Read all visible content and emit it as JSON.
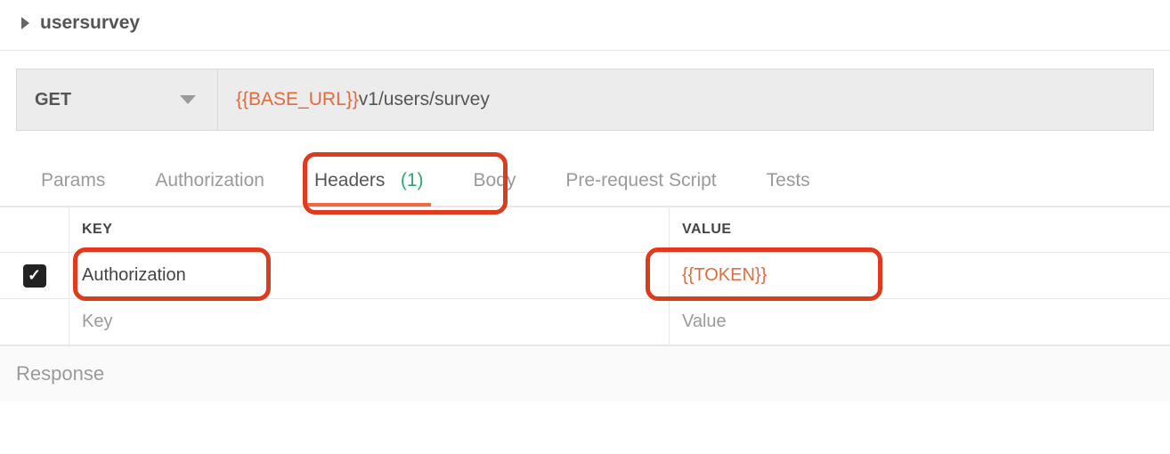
{
  "request": {
    "name": "usersurvey",
    "method": "GET",
    "url_variable": "{{BASE_URL}}",
    "url_path": "v1/users/survey"
  },
  "tabs": {
    "params": "Params",
    "authorization": "Authorization",
    "headers_label": "Headers",
    "headers_count": "(1)",
    "body": "Body",
    "prerequest": "Pre-request Script",
    "tests": "Tests"
  },
  "headers_grid": {
    "key_header": "KEY",
    "value_header": "VALUE",
    "rows": [
      {
        "enabled": true,
        "key": "Authorization",
        "value": "{{TOKEN}}"
      }
    ],
    "new_key_placeholder": "Key",
    "new_value_placeholder": "Value"
  },
  "response_label": "Response",
  "icons": {
    "check": "✓"
  }
}
